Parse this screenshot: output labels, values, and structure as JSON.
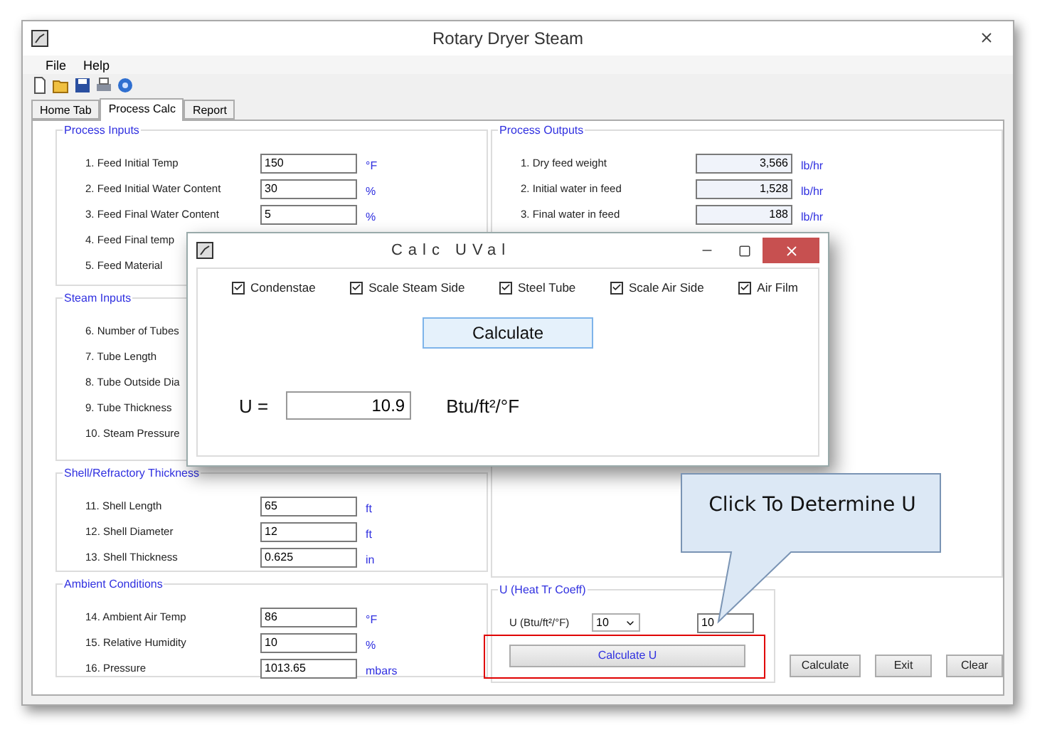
{
  "window": {
    "title": "Rotary Dryer Steam"
  },
  "menu": [
    "File",
    "Help"
  ],
  "tabs": [
    {
      "label": "Home Tab",
      "selected": false
    },
    {
      "label": "Process Calc",
      "selected": true
    },
    {
      "label": "Report",
      "selected": false
    }
  ],
  "left_groups": [
    {
      "title": "Process Inputs",
      "rows": [
        {
          "label": "1. Feed Initial Temp",
          "value": "150",
          "unit": "°F"
        },
        {
          "label": "2. Feed Initial Water Content",
          "value": "30",
          "unit": "%"
        },
        {
          "label": "3. Feed Final Water Content",
          "value": "5",
          "unit": "%"
        },
        {
          "label": "4. Feed Final temp"
        },
        {
          "label": "5. Feed Material"
        }
      ]
    },
    {
      "title": "Steam Inputs",
      "rows": [
        {
          "label": "6. Number of Tubes"
        },
        {
          "label": "7. Tube Length"
        },
        {
          "label": "8. Tube Outside Dia"
        },
        {
          "label": "9. Tube Thickness"
        },
        {
          "label": "10. Steam Pressure"
        }
      ]
    },
    {
      "title": "Shell/Refractory Thickness",
      "rows": [
        {
          "label": "11. Shell Length",
          "value": "65",
          "unit": "ft"
        },
        {
          "label": "12. Shell Diameter",
          "value": "12",
          "unit": "ft"
        },
        {
          "label": "13. Shell Thickness",
          "value": "0.625",
          "unit": "in"
        }
      ]
    },
    {
      "title": "Ambient Conditions",
      "rows": [
        {
          "label": "14. Ambient Air Temp",
          "value": "86",
          "unit": "°F"
        },
        {
          "label": "15. Relative Humidity",
          "value": "10",
          "unit": "%"
        },
        {
          "label": "16. Pressure",
          "value": "1013.65",
          "unit": "mbars"
        }
      ]
    }
  ],
  "process_outputs": {
    "title": "Process Outputs",
    "rows": [
      {
        "label": "1. Dry feed weight",
        "value": "3,566",
        "unit": "lb/hr"
      },
      {
        "label": "2. Initial water in feed",
        "value": "1,528",
        "unit": "lb/hr"
      },
      {
        "label": "3. Final water in feed",
        "value": "188",
        "unit": "lb/hr"
      }
    ]
  },
  "u_group": {
    "title": "U (Heat Tr Coeff)",
    "label": "U (Btu/ft²/°F)",
    "select_value": "10",
    "input_value": "10",
    "button": "Calculate U"
  },
  "buttons": [
    "Calculate",
    "Exit",
    "Clear"
  ],
  "dialog": {
    "title": "Calc UVal",
    "checkboxes": [
      {
        "label": "Condenstae",
        "checked": true
      },
      {
        "label": "Scale Steam Side",
        "checked": true
      },
      {
        "label": "Steel Tube",
        "checked": true
      },
      {
        "label": "Scale Air Side",
        "checked": true
      },
      {
        "label": "Air Film",
        "checked": true
      }
    ],
    "button": "Calculate",
    "result_label": "U =",
    "result_value": "10.9",
    "result_unit": "Btu/ft²/°F"
  },
  "callout": {
    "text": "Click To Determine U"
  }
}
